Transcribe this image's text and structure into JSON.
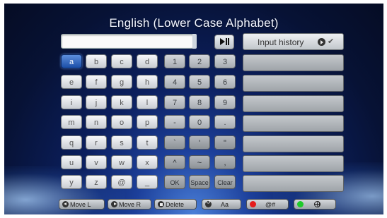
{
  "title": "English (Lower Case Alphabet)",
  "input": {
    "value": ""
  },
  "history": {
    "header_label": "Input history",
    "items": [
      "",
      "",
      "",
      "",
      "",
      "",
      ""
    ]
  },
  "keyboard": {
    "letters": [
      [
        "a",
        "b",
        "c",
        "d"
      ],
      [
        "e",
        "f",
        "g",
        "h"
      ],
      [
        "i",
        "j",
        "k",
        "l"
      ],
      [
        "m",
        "n",
        "o",
        "p"
      ],
      [
        "q",
        "r",
        "s",
        "t"
      ],
      [
        "u",
        "v",
        "w",
        "x"
      ],
      [
        "y",
        "z",
        "@",
        "_"
      ]
    ],
    "numbers": [
      [
        "1",
        "2",
        "3"
      ],
      [
        "4",
        "5",
        "6"
      ],
      [
        "7",
        "8",
        "9"
      ],
      [
        "-",
        "0",
        "."
      ],
      [
        "`",
        "'",
        "\""
      ],
      [
        "^",
        "~",
        ","
      ],
      [
        "OK",
        "Space",
        "Clear"
      ]
    ],
    "selected": "a"
  },
  "footer": {
    "move_left": "Move L",
    "move_right": "Move R",
    "delete": "Delete",
    "case": "Aa",
    "symbols": "@#"
  },
  "colors": {
    "selected_key": "#2a5db8",
    "red_button": "#e51c1c",
    "green_button": "#1ecb2a"
  }
}
